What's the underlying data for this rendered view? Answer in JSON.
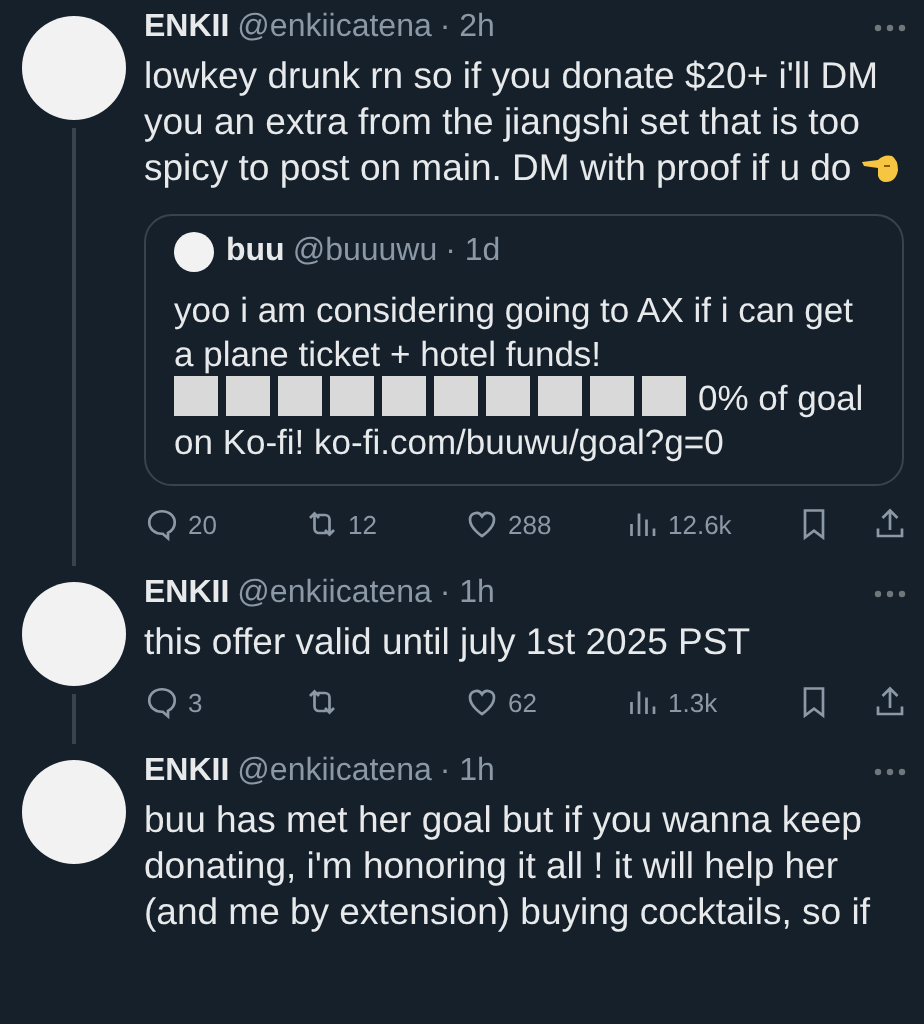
{
  "tweets": [
    {
      "name": "ENKII",
      "handle": "@enkiicatena",
      "time": "· 2h",
      "text": "lowkey drunk rn so if you donate $20+ i'll DM you an extra from the jiangshi set that is too spicy to post on main.  DM with proof if u do",
      "emoji": true,
      "thread_line": true,
      "quote": {
        "name": "buu",
        "handle": "@buuuwu",
        "time": "· 1d",
        "text_before": "yoo i am considering going to AX if i can get a plane ticket + hotel funds!",
        "goal_text": "0% of goal",
        "text_after": "on Ko-fi! ko-fi.com/buuwu/goal?g=0"
      },
      "stats": {
        "replies": "20",
        "reposts": "12",
        "likes": "288",
        "views": "12.6k"
      }
    },
    {
      "name": "ENKII",
      "handle": "@enkiicatena",
      "time": "· 1h",
      "text": "this offer valid until  july 1st 2025 PST",
      "thread_line": true,
      "stats": {
        "replies": "3",
        "likes": "62",
        "views": "1.3k"
      }
    },
    {
      "name": "ENKII",
      "handle": "@enkiicatena",
      "time": "· 1h",
      "text": "buu has met her goal but if you wanna keep donating, i'm honoring it all ! it will help her (and me by extension) buying cocktails, so if"
    }
  ]
}
